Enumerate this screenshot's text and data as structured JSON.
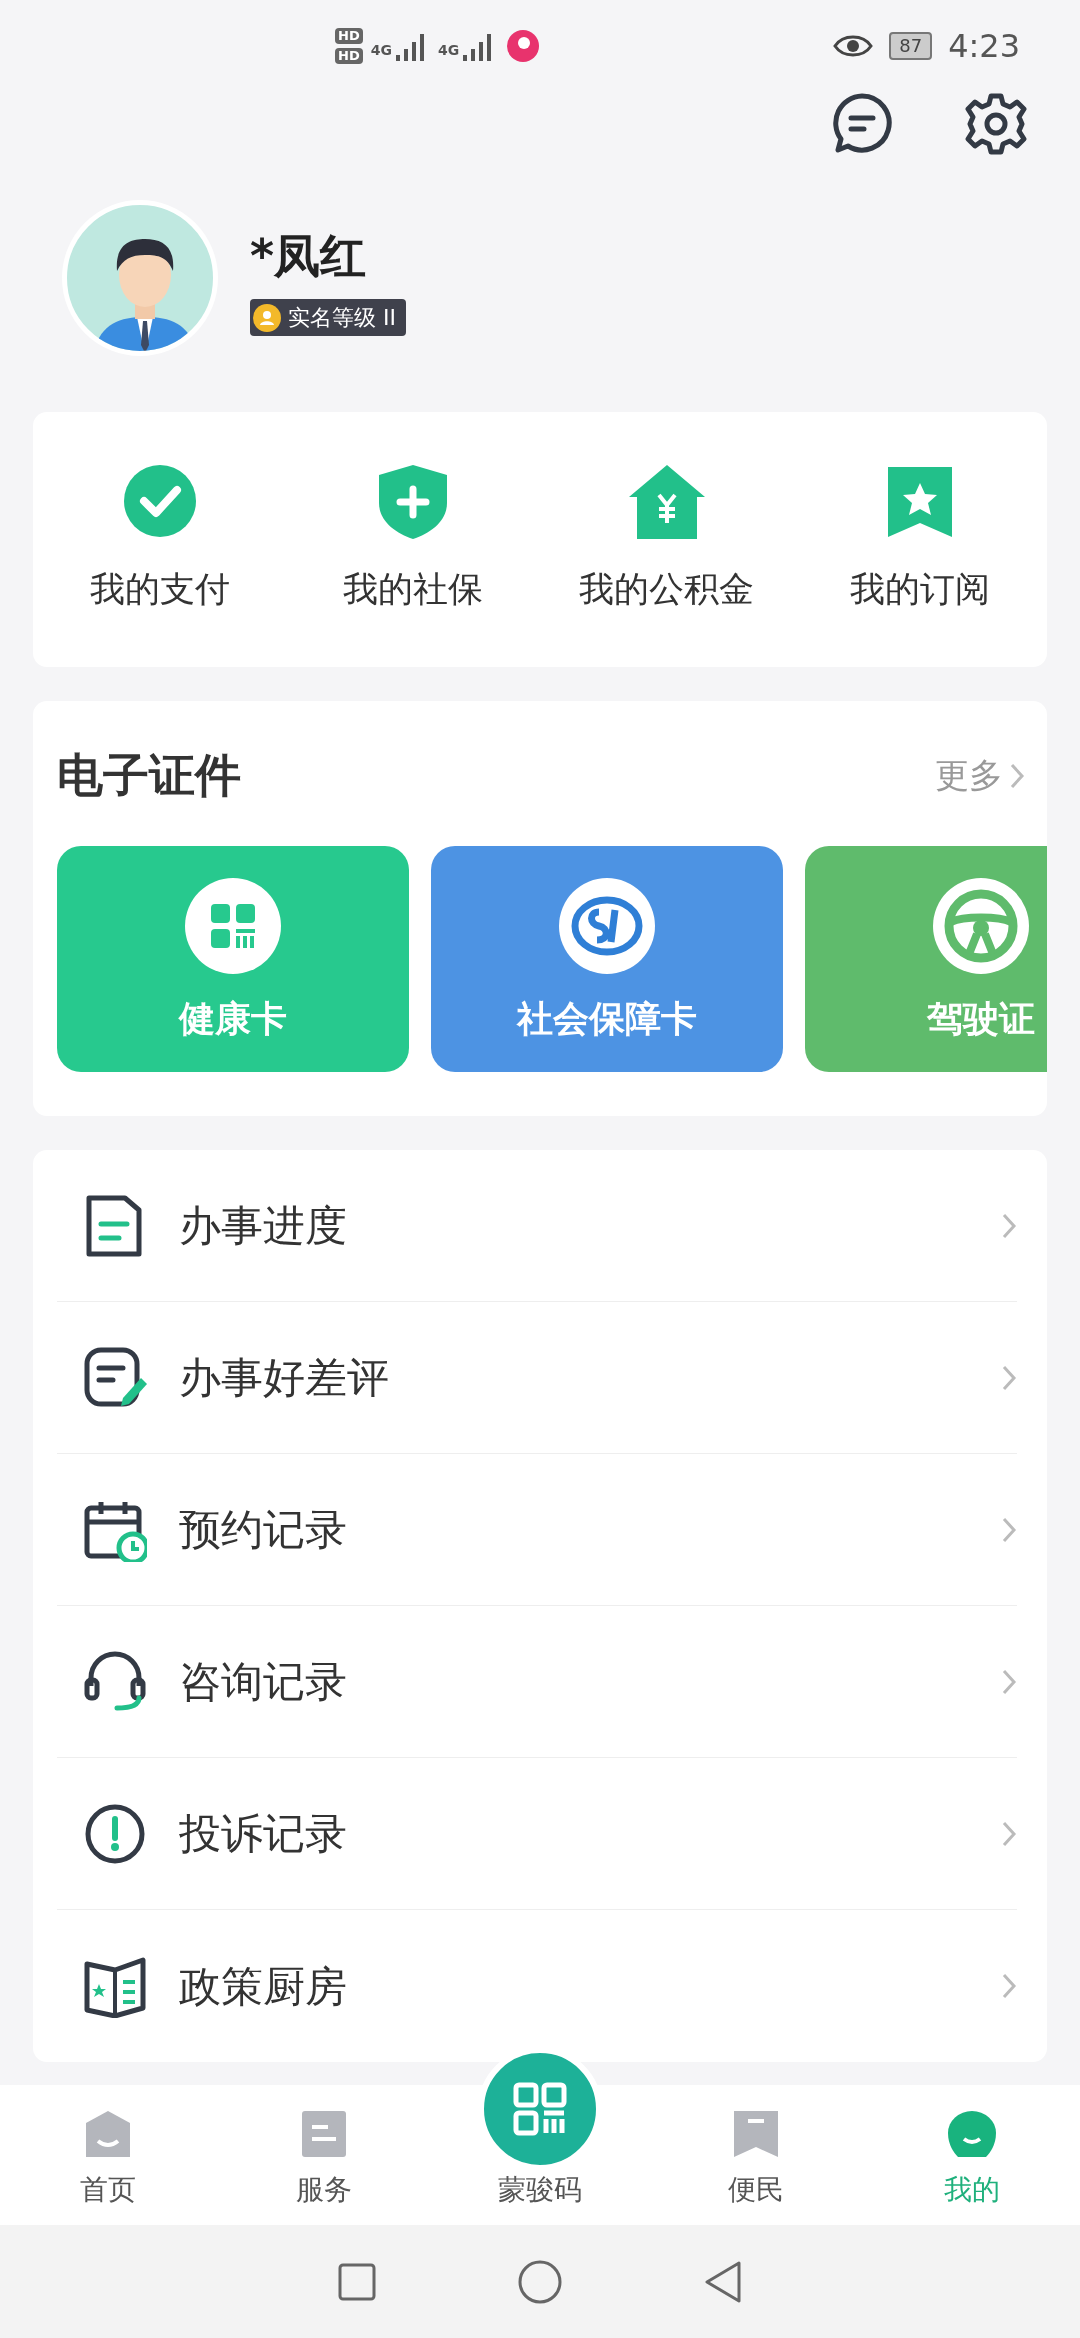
{
  "status_bar": {
    "hd": [
      "HD",
      "HD"
    ],
    "network": [
      "4G",
      "4G"
    ],
    "battery": "87",
    "time": "4:23"
  },
  "profile": {
    "name": "*凤红",
    "badge": "实名等级 II"
  },
  "quick_links": [
    {
      "label": "我的支付",
      "kind": "check"
    },
    {
      "label": "我的社保",
      "kind": "shield"
    },
    {
      "label": "我的公积金",
      "kind": "house"
    },
    {
      "label": "我的订阅",
      "kind": "bookmark"
    }
  ],
  "certificates": {
    "title": "电子证件",
    "more": "更多",
    "cards": [
      {
        "label": "健康卡",
        "kind": "health",
        "color": "#27c98e"
      },
      {
        "label": "社会保障卡",
        "kind": "social",
        "color": "#4d93e3"
      },
      {
        "label": "驾驶证",
        "kind": "driver",
        "color": "#5fbb6c"
      }
    ]
  },
  "menu": [
    {
      "label": "办事进度",
      "kind": "progress"
    },
    {
      "label": "办事好差评",
      "kind": "review"
    },
    {
      "label": "预约记录",
      "kind": "calendar"
    },
    {
      "label": "咨询记录",
      "kind": "headset"
    },
    {
      "label": "投诉记录",
      "kind": "alert"
    },
    {
      "label": "政策厨房",
      "kind": "book"
    }
  ],
  "tab_bar": [
    {
      "label": "首页",
      "kind": "home",
      "selected": false
    },
    {
      "label": "服务",
      "kind": "service",
      "selected": false
    },
    {
      "label": "蒙骏码",
      "kind": "qr",
      "selected": false
    },
    {
      "label": "便民",
      "kind": "bookmark",
      "selected": false
    },
    {
      "label": "我的",
      "kind": "mine",
      "selected": true
    }
  ]
}
